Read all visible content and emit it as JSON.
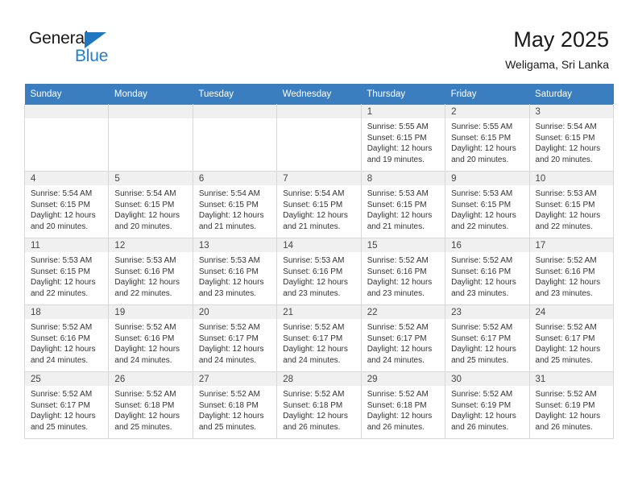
{
  "brand": {
    "name_part1": "General",
    "name_part2": "Blue",
    "accent_color": "#1f7fd0",
    "header_color": "#3a7ec0"
  },
  "header": {
    "title": "May 2025",
    "subtitle": "Weligama, Sri Lanka"
  },
  "weekdays": [
    "Sunday",
    "Monday",
    "Tuesday",
    "Wednesday",
    "Thursday",
    "Friday",
    "Saturday"
  ],
  "labels": {
    "sunrise_prefix": "Sunrise:",
    "sunset_prefix": "Sunset:",
    "daylight_prefix": "Daylight:"
  },
  "weeks": [
    [
      {
        "day": "",
        "empty": true
      },
      {
        "day": "",
        "empty": true
      },
      {
        "day": "",
        "empty": true
      },
      {
        "day": "",
        "empty": true
      },
      {
        "day": "1",
        "sunrise": "Sunrise: 5:55 AM",
        "sunset": "Sunset: 6:15 PM",
        "daylight1": "Daylight: 12 hours",
        "daylight2": "and 19 minutes."
      },
      {
        "day": "2",
        "sunrise": "Sunrise: 5:55 AM",
        "sunset": "Sunset: 6:15 PM",
        "daylight1": "Daylight: 12 hours",
        "daylight2": "and 20 minutes."
      },
      {
        "day": "3",
        "sunrise": "Sunrise: 5:54 AM",
        "sunset": "Sunset: 6:15 PM",
        "daylight1": "Daylight: 12 hours",
        "daylight2": "and 20 minutes."
      }
    ],
    [
      {
        "day": "4",
        "sunrise": "Sunrise: 5:54 AM",
        "sunset": "Sunset: 6:15 PM",
        "daylight1": "Daylight: 12 hours",
        "daylight2": "and 20 minutes."
      },
      {
        "day": "5",
        "sunrise": "Sunrise: 5:54 AM",
        "sunset": "Sunset: 6:15 PM",
        "daylight1": "Daylight: 12 hours",
        "daylight2": "and 20 minutes."
      },
      {
        "day": "6",
        "sunrise": "Sunrise: 5:54 AM",
        "sunset": "Sunset: 6:15 PM",
        "daylight1": "Daylight: 12 hours",
        "daylight2": "and 21 minutes."
      },
      {
        "day": "7",
        "sunrise": "Sunrise: 5:54 AM",
        "sunset": "Sunset: 6:15 PM",
        "daylight1": "Daylight: 12 hours",
        "daylight2": "and 21 minutes."
      },
      {
        "day": "8",
        "sunrise": "Sunrise: 5:53 AM",
        "sunset": "Sunset: 6:15 PM",
        "daylight1": "Daylight: 12 hours",
        "daylight2": "and 21 minutes."
      },
      {
        "day": "9",
        "sunrise": "Sunrise: 5:53 AM",
        "sunset": "Sunset: 6:15 PM",
        "daylight1": "Daylight: 12 hours",
        "daylight2": "and 22 minutes."
      },
      {
        "day": "10",
        "sunrise": "Sunrise: 5:53 AM",
        "sunset": "Sunset: 6:15 PM",
        "daylight1": "Daylight: 12 hours",
        "daylight2": "and 22 minutes."
      }
    ],
    [
      {
        "day": "11",
        "sunrise": "Sunrise: 5:53 AM",
        "sunset": "Sunset: 6:15 PM",
        "daylight1": "Daylight: 12 hours",
        "daylight2": "and 22 minutes."
      },
      {
        "day": "12",
        "sunrise": "Sunrise: 5:53 AM",
        "sunset": "Sunset: 6:16 PM",
        "daylight1": "Daylight: 12 hours",
        "daylight2": "and 22 minutes."
      },
      {
        "day": "13",
        "sunrise": "Sunrise: 5:53 AM",
        "sunset": "Sunset: 6:16 PM",
        "daylight1": "Daylight: 12 hours",
        "daylight2": "and 23 minutes."
      },
      {
        "day": "14",
        "sunrise": "Sunrise: 5:53 AM",
        "sunset": "Sunset: 6:16 PM",
        "daylight1": "Daylight: 12 hours",
        "daylight2": "and 23 minutes."
      },
      {
        "day": "15",
        "sunrise": "Sunrise: 5:52 AM",
        "sunset": "Sunset: 6:16 PM",
        "daylight1": "Daylight: 12 hours",
        "daylight2": "and 23 minutes."
      },
      {
        "day": "16",
        "sunrise": "Sunrise: 5:52 AM",
        "sunset": "Sunset: 6:16 PM",
        "daylight1": "Daylight: 12 hours",
        "daylight2": "and 23 minutes."
      },
      {
        "day": "17",
        "sunrise": "Sunrise: 5:52 AM",
        "sunset": "Sunset: 6:16 PM",
        "daylight1": "Daylight: 12 hours",
        "daylight2": "and 23 minutes."
      }
    ],
    [
      {
        "day": "18",
        "sunrise": "Sunrise: 5:52 AM",
        "sunset": "Sunset: 6:16 PM",
        "daylight1": "Daylight: 12 hours",
        "daylight2": "and 24 minutes."
      },
      {
        "day": "19",
        "sunrise": "Sunrise: 5:52 AM",
        "sunset": "Sunset: 6:16 PM",
        "daylight1": "Daylight: 12 hours",
        "daylight2": "and 24 minutes."
      },
      {
        "day": "20",
        "sunrise": "Sunrise: 5:52 AM",
        "sunset": "Sunset: 6:17 PM",
        "daylight1": "Daylight: 12 hours",
        "daylight2": "and 24 minutes."
      },
      {
        "day": "21",
        "sunrise": "Sunrise: 5:52 AM",
        "sunset": "Sunset: 6:17 PM",
        "daylight1": "Daylight: 12 hours",
        "daylight2": "and 24 minutes."
      },
      {
        "day": "22",
        "sunrise": "Sunrise: 5:52 AM",
        "sunset": "Sunset: 6:17 PM",
        "daylight1": "Daylight: 12 hours",
        "daylight2": "and 24 minutes."
      },
      {
        "day": "23",
        "sunrise": "Sunrise: 5:52 AM",
        "sunset": "Sunset: 6:17 PM",
        "daylight1": "Daylight: 12 hours",
        "daylight2": "and 25 minutes."
      },
      {
        "day": "24",
        "sunrise": "Sunrise: 5:52 AM",
        "sunset": "Sunset: 6:17 PM",
        "daylight1": "Daylight: 12 hours",
        "daylight2": "and 25 minutes."
      }
    ],
    [
      {
        "day": "25",
        "sunrise": "Sunrise: 5:52 AM",
        "sunset": "Sunset: 6:17 PM",
        "daylight1": "Daylight: 12 hours",
        "daylight2": "and 25 minutes."
      },
      {
        "day": "26",
        "sunrise": "Sunrise: 5:52 AM",
        "sunset": "Sunset: 6:18 PM",
        "daylight1": "Daylight: 12 hours",
        "daylight2": "and 25 minutes."
      },
      {
        "day": "27",
        "sunrise": "Sunrise: 5:52 AM",
        "sunset": "Sunset: 6:18 PM",
        "daylight1": "Daylight: 12 hours",
        "daylight2": "and 25 minutes."
      },
      {
        "day": "28",
        "sunrise": "Sunrise: 5:52 AM",
        "sunset": "Sunset: 6:18 PM",
        "daylight1": "Daylight: 12 hours",
        "daylight2": "and 26 minutes."
      },
      {
        "day": "29",
        "sunrise": "Sunrise: 5:52 AM",
        "sunset": "Sunset: 6:18 PM",
        "daylight1": "Daylight: 12 hours",
        "daylight2": "and 26 minutes."
      },
      {
        "day": "30",
        "sunrise": "Sunrise: 5:52 AM",
        "sunset": "Sunset: 6:19 PM",
        "daylight1": "Daylight: 12 hours",
        "daylight2": "and 26 minutes."
      },
      {
        "day": "31",
        "sunrise": "Sunrise: 5:52 AM",
        "sunset": "Sunset: 6:19 PM",
        "daylight1": "Daylight: 12 hours",
        "daylight2": "and 26 minutes."
      }
    ]
  ]
}
